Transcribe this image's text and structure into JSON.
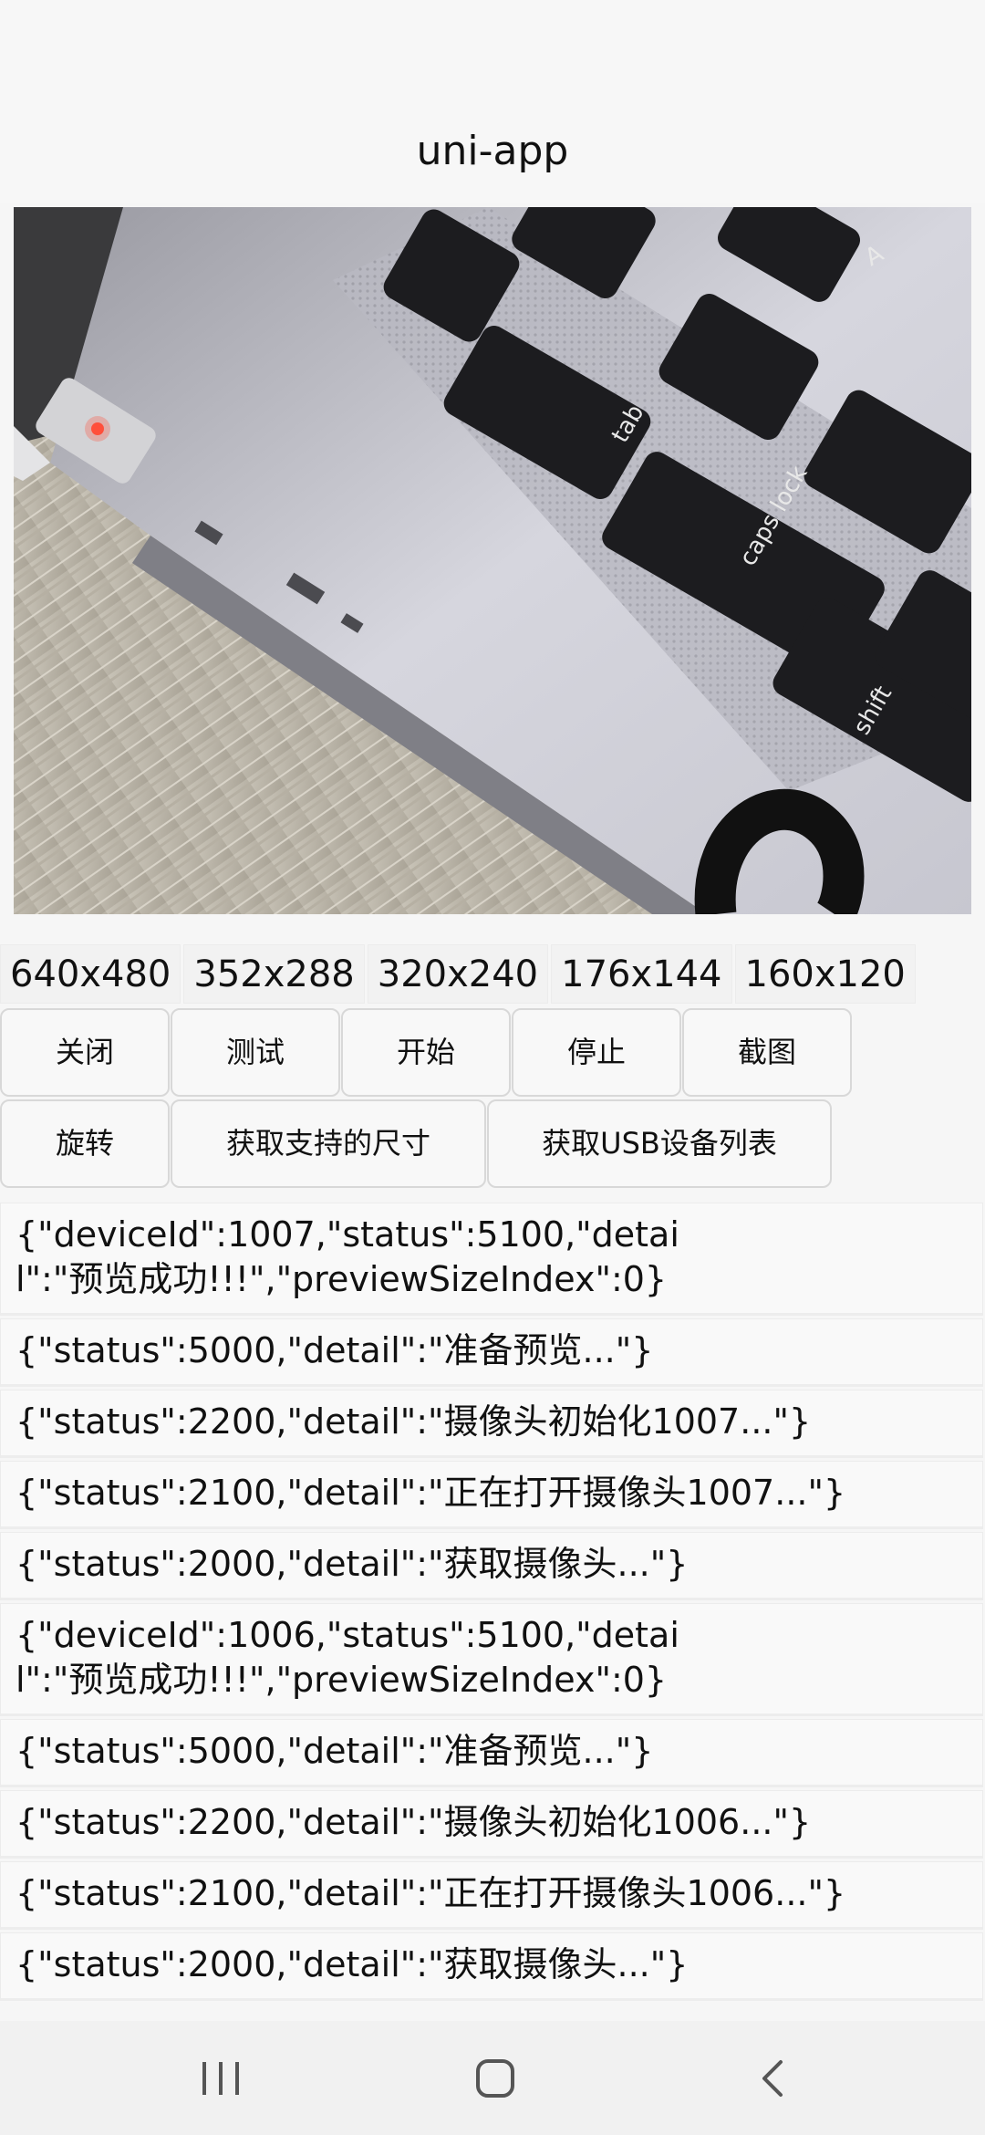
{
  "header": {
    "title": "uni-app"
  },
  "preview": {
    "description_icon": "camera-preview-image"
  },
  "resolutions": [
    "640x480",
    "352x288",
    "320x240",
    "176x144",
    "160x120"
  ],
  "controls": {
    "close": "关闭",
    "test": "测试",
    "start": "开始",
    "stop": "停止",
    "screenshot": "截图",
    "rotate": "旋转",
    "get_sizes": "获取支持的尺寸",
    "get_usb_list": "获取USB设备列表"
  },
  "logs": [
    "{\"deviceId\":1007,\"status\":5100,\"detail\":\"预览成功!!!\",\"previewSizeIndex\":0}",
    "{\"status\":5000,\"detail\":\"准备预览...\"}",
    "{\"status\":2200,\"detail\":\"摄像头初始化1007...\"}",
    "{\"status\":2100,\"detail\":\"正在打开摄像头1007...\"}",
    "{\"status\":2000,\"detail\":\"获取摄像头...\"}",
    "{\"deviceId\":1006,\"status\":5100,\"detail\":\"预览成功!!!\",\"previewSizeIndex\":0}",
    "{\"status\":5000,\"detail\":\"准备预览...\"}",
    "{\"status\":2200,\"detail\":\"摄像头初始化1006...\"}",
    "{\"status\":2100,\"detail\":\"正在打开摄像头1006...\"}",
    "{\"status\":2000,\"detail\":\"获取摄像头...\"}"
  ],
  "navbar": {
    "recent_icon": "recent-apps-icon",
    "home_icon": "home-icon",
    "back_icon": "back-icon"
  }
}
